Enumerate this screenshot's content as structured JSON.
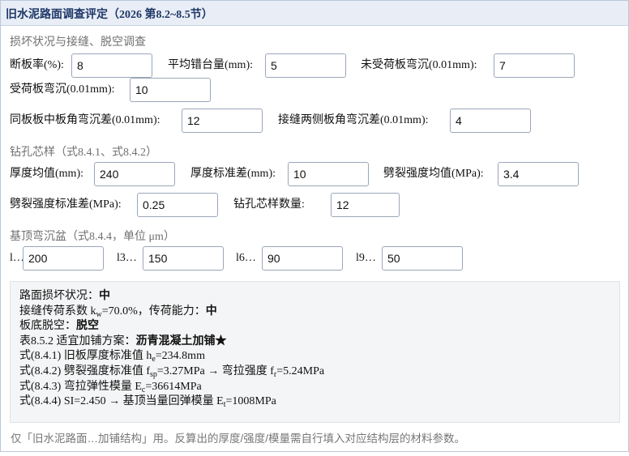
{
  "window": {
    "title": "旧水泥路面调查评定（2026 第8.2~8.5节）"
  },
  "sections": {
    "damage": "损坏状况与接缝、脱空调查",
    "core": "钻孔芯样（式8.4.1、式8.4.2）",
    "deflection": "基顶弯沉盆（式8.4.4，单位 μm）"
  },
  "damage": {
    "broken_rate": {
      "label": "断板率(%):",
      "value": "8"
    },
    "faulting": {
      "label": "平均错台量(mm):",
      "value": "5"
    },
    "unloaded_defl": {
      "label": "未受荷板弯沉(0.01mm):",
      "value": "7"
    },
    "loaded_defl": {
      "label": "受荷板弯沉(0.01mm):",
      "value": "10"
    },
    "same_slab_corner": {
      "label": "同板板中板角弯沉差(0.01mm):",
      "value": "12"
    },
    "joint_corner": {
      "label": "接缝两侧板角弯沉差(0.01mm):",
      "value": "4"
    }
  },
  "core": {
    "thick_mean": {
      "label": "厚度均值(mm):",
      "value": "240"
    },
    "thick_sd": {
      "label": "厚度标准差(mm):",
      "value": "10"
    },
    "split_mean": {
      "label": "劈裂强度均值(MPa):",
      "value": "3.4"
    },
    "split_sd": {
      "label": "劈裂强度标准差(MPa):",
      "value": "0.25"
    },
    "count": {
      "label": "钻孔芯样数量:",
      "value": "12"
    }
  },
  "basin": {
    "l0": {
      "label": "l…",
      "value": "200"
    },
    "l3": {
      "label": "l3…",
      "value": "150"
    },
    "l6": {
      "label": "l6…",
      "value": "90"
    },
    "l9": {
      "label": "l9…",
      "value": "50"
    }
  },
  "result": {
    "condition_label": "路面损坏状况：",
    "condition_value": "中",
    "kw_prefix": "接缝传荷系数 k",
    "kw_sub": "w",
    "kw_mid": "=70.0%，传荷能力：",
    "kw_value": "中",
    "void_label": "板底脱空：",
    "void_value": "脱空",
    "scheme_label": "表8.5.2 适宜加铺方案：",
    "scheme_value": "沥青混凝土加铺★",
    "he_prefix": "式(8.4.1) 旧板厚度标准值 h",
    "he_sub": "e",
    "he_suffix": "=234.8mm",
    "fsp_prefix": "式(8.4.2) 劈裂强度标准值 f",
    "fsp_sub": "sp",
    "fsp_mid": "=3.27MPa → 弯拉强度 f",
    "fr_sub": "r",
    "fr_suffix": "=5.24MPa",
    "ec_prefix": "式(8.4.3) 弯拉弹性模量 E",
    "ec_sub": "c",
    "ec_suffix": "=36614MPa",
    "si_prefix": "式(8.4.4) SI=2.450 → 基顶当量回弹模量 E",
    "et_sub": "t",
    "et_suffix": "=1008MPa"
  },
  "note": "仅「旧水泥路面…加铺结构」用。反算出的厚度/强度/模量需自行填入对应结构层的材料参数。"
}
